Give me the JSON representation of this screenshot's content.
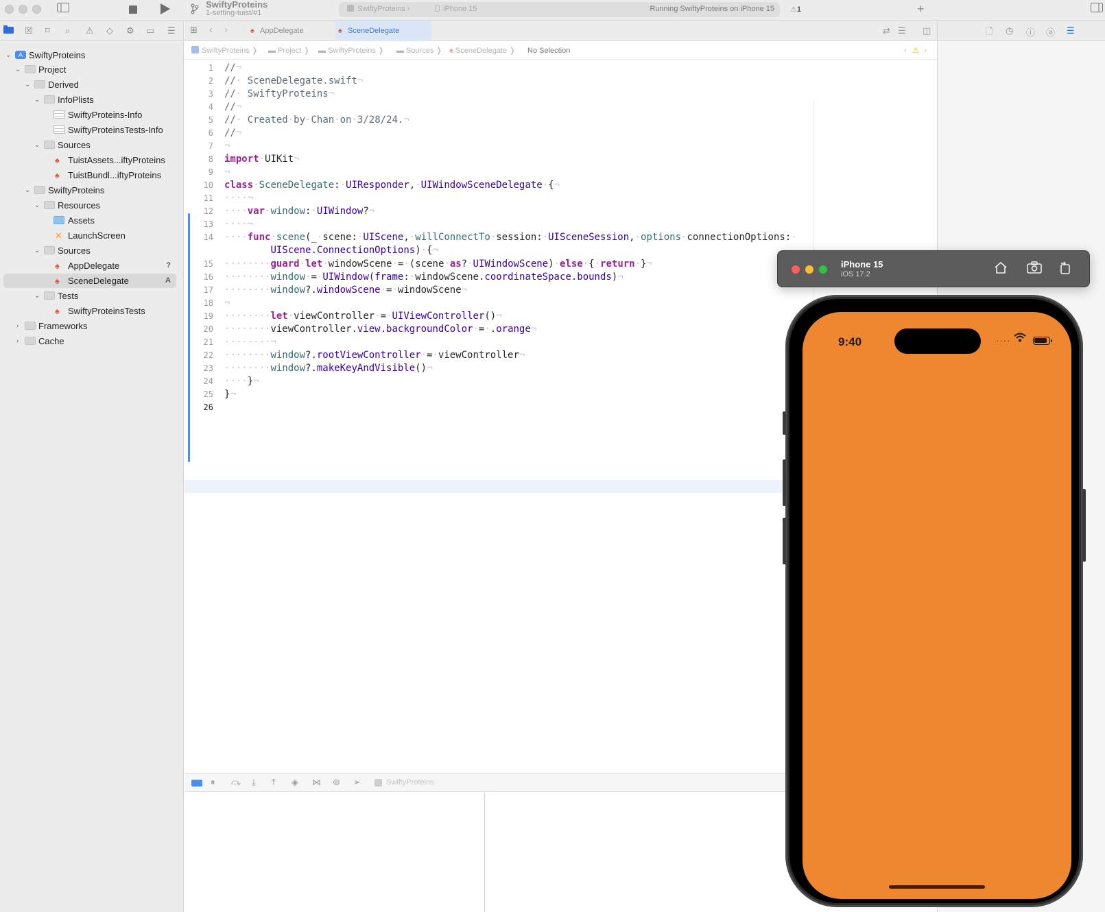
{
  "toolbar": {
    "project_name": "SwiftyProteins",
    "branch": "1-setting-tuist/#1",
    "status": {
      "scheme": "SwiftyProteins",
      "device": "iPhone 15",
      "message": "Running SwiftyProteins on iPhone 15"
    },
    "warning_count": "1",
    "icons": [
      "stop-icon",
      "play-icon",
      "branch-icon",
      "warning-icon",
      "plus-icon",
      "sidebar-toggle-icon"
    ]
  },
  "navigator": {
    "tree": [
      {
        "label": "SwiftyProteins",
        "icon": "project-icon",
        "depth": 0,
        "expanded": true
      },
      {
        "label": "Project",
        "icon": "folder-icon",
        "depth": 1,
        "expanded": true
      },
      {
        "label": "Derived",
        "icon": "folder-icon",
        "depth": 2,
        "expanded": true
      },
      {
        "label": "InfoPlists",
        "icon": "folder-icon",
        "depth": 3,
        "expanded": true
      },
      {
        "label": "SwiftyProteins-Info",
        "icon": "plist-icon",
        "depth": 4
      },
      {
        "label": "SwiftyProteinsTests-Info",
        "icon": "plist-icon",
        "depth": 4
      },
      {
        "label": "Sources",
        "icon": "folder-icon",
        "depth": 3,
        "expanded": true
      },
      {
        "label": "TuistAssets...iftyProteins",
        "icon": "swift-file-icon",
        "depth": 4
      },
      {
        "label": "TuistBundl...iftyProteins",
        "icon": "swift-file-icon",
        "depth": 4
      },
      {
        "label": "SwiftyProteins",
        "icon": "folder-icon",
        "depth": 2,
        "expanded": true
      },
      {
        "label": "Resources",
        "icon": "folder-icon",
        "depth": 3,
        "expanded": true
      },
      {
        "label": "Assets",
        "icon": "asset-catalog-icon",
        "depth": 4
      },
      {
        "label": "LaunchScreen",
        "icon": "storyboard-icon",
        "depth": 4
      },
      {
        "label": "Sources",
        "icon": "folder-icon",
        "depth": 3,
        "expanded": true
      },
      {
        "label": "AppDelegate",
        "icon": "swift-file-icon",
        "depth": 4,
        "badge": "?"
      },
      {
        "label": "SceneDelegate",
        "icon": "swift-file-icon",
        "depth": 4,
        "badge": "A",
        "selected": true
      },
      {
        "label": "Tests",
        "icon": "folder-icon",
        "depth": 3,
        "expanded": true
      },
      {
        "label": "SwiftyProteinsTests",
        "icon": "swift-file-icon",
        "depth": 4
      },
      {
        "label": "Frameworks",
        "icon": "folder-icon",
        "depth": 1,
        "expanded": false
      },
      {
        "label": "Cache",
        "icon": "folder-icon",
        "depth": 1,
        "expanded": false
      }
    ]
  },
  "editor": {
    "tabs": [
      {
        "label": "AppDelegate",
        "active": false
      },
      {
        "label": "SceneDelegate",
        "active": true
      }
    ],
    "breadcrumb": [
      "SwiftyProteins",
      "Project",
      "SwiftyProteins",
      "Sources",
      "SceneDelegate",
      "No Selection"
    ],
    "lines": [
      "1",
      "2",
      "3",
      "4",
      "5",
      "6",
      "7",
      "8",
      "9",
      "10",
      "11",
      "12",
      "13",
      "14",
      "15",
      "16",
      "17",
      "18",
      "19",
      "20",
      "21",
      "22",
      "23",
      "24",
      "25",
      "26"
    ],
    "current_line": "26"
  },
  "debug": {
    "scheme": "SwiftyProteins"
  },
  "simulator": {
    "device_name": "iPhone 15",
    "os_version": "iOS 17.2",
    "status_time": "9:40",
    "screen_color": "#ef8730"
  }
}
